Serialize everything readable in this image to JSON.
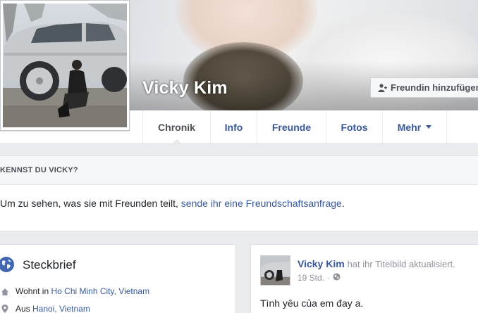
{
  "profile": {
    "name": "Vicky Kim",
    "add_friend_label": "Freundin hinzufügen"
  },
  "nav": {
    "tabs": [
      {
        "label": "Chronik",
        "active": true
      },
      {
        "label": "Info"
      },
      {
        "label": "Freunde"
      },
      {
        "label": "Fotos"
      },
      {
        "label": "Mehr",
        "has_caret": true
      }
    ]
  },
  "know": {
    "heading": "KENNST DU VICKY?",
    "body_prefix": "Um zu sehen, was sie mit Freunden teilt, ",
    "body_link": "sende ihr eine Freundschaftsanfrage",
    "body_suffix": "."
  },
  "intro": {
    "title": "Steckbrief",
    "rows": [
      {
        "icon": "home-icon",
        "prefix": "Wohnt in ",
        "link": "Ho Chi Minh City, Vietnam"
      },
      {
        "icon": "location-pin-icon",
        "prefix": "Aus ",
        "link": "Hanoi, Vietnam"
      }
    ]
  },
  "post": {
    "author": "Vicky Kim",
    "action": "hat ihr Titelbild aktualisiert.",
    "time": "19 Std.",
    "privacy_icon": "globe-icon",
    "text": "Tình yêu của em đay a."
  },
  "colors": {
    "link": "#365899",
    "page_bg": "#e9ebee",
    "text_muted": "#90949c"
  }
}
